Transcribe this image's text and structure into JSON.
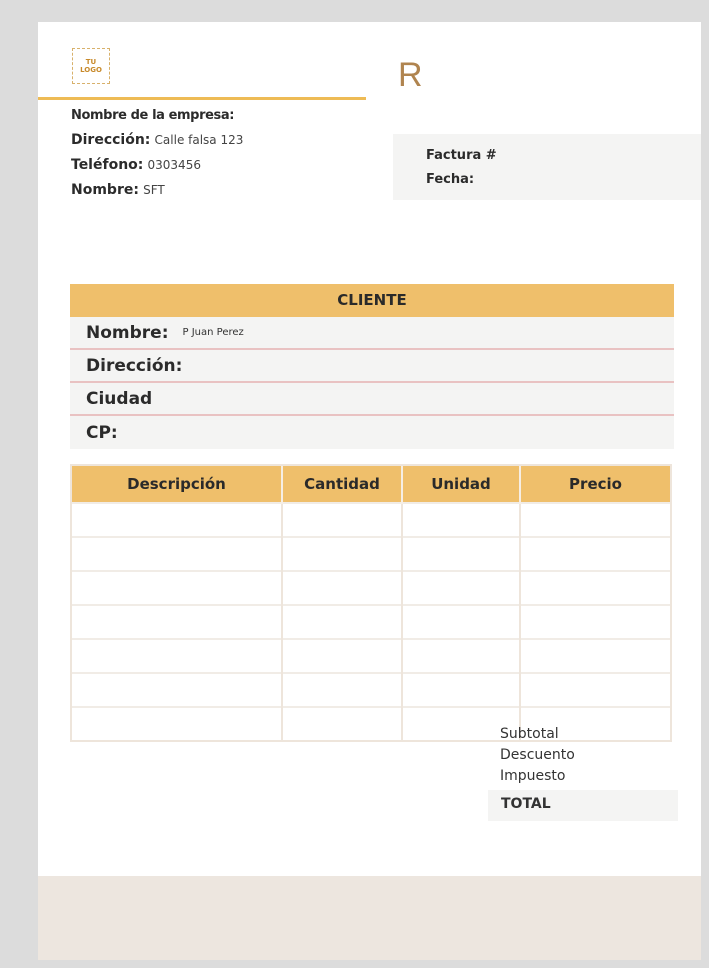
{
  "logo": {
    "line1": "TU",
    "line2": "LOGO"
  },
  "header": {
    "letter": "R"
  },
  "company": {
    "name_label": "Nombre de la empresa:",
    "address_label": "Dirección:",
    "address_value": "Calle falsa 123",
    "phone_label": "Teléfono:",
    "phone_value": "0303456",
    "contact_label": "Nombre:",
    "contact_value": "SFT"
  },
  "invoice": {
    "number_label": "Factura #",
    "date_label": "Fecha:"
  },
  "client": {
    "title": "CLIENTE",
    "name_label": "Nombre:",
    "name_value": "P Juan Perez",
    "address_label": "Dirección:",
    "city_label": "Ciudad",
    "zip_label": "CP:"
  },
  "items": {
    "headers": [
      "Descripción",
      "Cantidad",
      "Unidad",
      "Precio"
    ]
  },
  "totals": {
    "subtotal": "Subtotal",
    "discount": "Descuento",
    "tax": "Impuesto",
    "total": "TOTAL"
  },
  "colors": {
    "accent": "#efbf6b",
    "panel": "#f4f4f3",
    "footer": "#ede6df"
  }
}
